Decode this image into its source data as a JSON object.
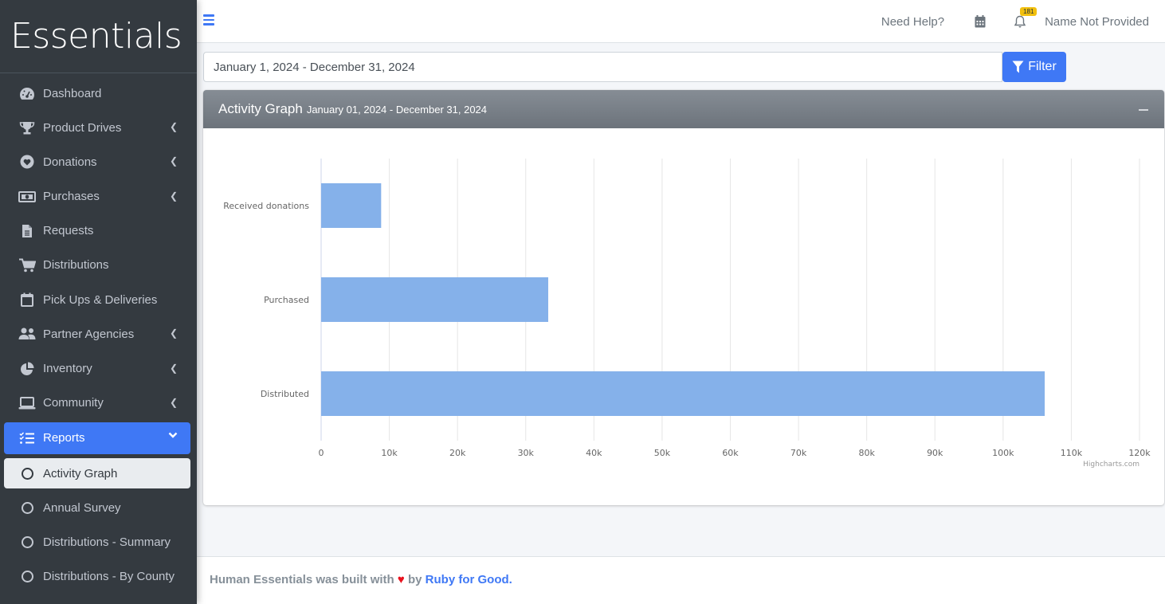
{
  "brand": {
    "name": "Essentials"
  },
  "topbar": {
    "help_label": "Need Help?",
    "notification_count": "181",
    "user_name": "Name Not Provided"
  },
  "sidebar": {
    "items": [
      {
        "label": "Dashboard",
        "icon": "dashboard-icon",
        "has_submenu": false
      },
      {
        "label": "Product Drives",
        "icon": "trophy-icon",
        "has_submenu": true
      },
      {
        "label": "Donations",
        "icon": "heart-circle-icon",
        "has_submenu": true
      },
      {
        "label": "Purchases",
        "icon": "money-bill-icon",
        "has_submenu": true
      },
      {
        "label": "Requests",
        "icon": "file-icon",
        "has_submenu": false
      },
      {
        "label": "Distributions",
        "icon": "cart-icon",
        "has_submenu": false
      },
      {
        "label": "Pick Ups & Deliveries",
        "icon": "calendar-icon",
        "has_submenu": false
      },
      {
        "label": "Partner Agencies",
        "icon": "users-icon",
        "has_submenu": true
      },
      {
        "label": "Inventory",
        "icon": "pie-chart-icon",
        "has_submenu": true
      },
      {
        "label": "Community",
        "icon": "laptop-icon",
        "has_submenu": true
      },
      {
        "label": "Reports",
        "icon": "tasks-icon",
        "has_submenu": true,
        "expanded": true,
        "active": true
      }
    ],
    "report_subitems": [
      {
        "label": "Activity Graph",
        "active": true
      },
      {
        "label": "Annual Survey"
      },
      {
        "label": "Distributions - Summary"
      },
      {
        "label": "Distributions - By County"
      }
    ]
  },
  "filter": {
    "date_range_value": "January 1, 2024 - December 31, 2024",
    "button_label": "Filter"
  },
  "card": {
    "title": "Activity Graph",
    "subtitle": "January 01, 2024 - December 31, 2024"
  },
  "chart_data": {
    "type": "bar",
    "orientation": "horizontal",
    "title": "",
    "xlabel": "",
    "ylabel": "",
    "categories": [
      "Received donations",
      "Purchased",
      "Distributed"
    ],
    "values": [
      8800,
      33300,
      106100
    ],
    "xlim": [
      0,
      120000
    ],
    "ticks": [
      0,
      10000,
      20000,
      30000,
      40000,
      50000,
      60000,
      70000,
      80000,
      90000,
      100000,
      110000,
      120000
    ],
    "tick_labels": [
      "0",
      "10k",
      "20k",
      "30k",
      "40k",
      "50k",
      "60k",
      "70k",
      "80k",
      "90k",
      "100k",
      "110k",
      "120k"
    ],
    "grid": true,
    "legend": "none",
    "bar_color": "#85b1ea",
    "credits": "Highcharts.com"
  },
  "footer": {
    "text_before": "Human Essentials was built with",
    "text_by": "by",
    "link_label": "Ruby for Good",
    "text_after": "."
  }
}
